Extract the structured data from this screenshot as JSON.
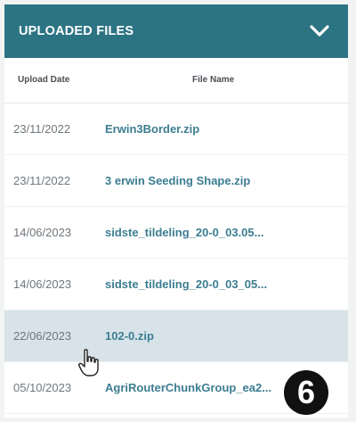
{
  "header": {
    "title": "UPLOADED FILES",
    "toggle_icon": "chevron-down-icon",
    "bg_color": "#2c7483"
  },
  "columns": {
    "upload_date": "Upload Date",
    "file_name": "File Name"
  },
  "rows": [
    {
      "date": "23/11/2022",
      "name": "Erwin3Border.zip"
    },
    {
      "date": "23/11/2022",
      "name": "3 erwin Seeding Shape.zip"
    },
    {
      "date": "14/06/2023",
      "name": "sidste_tildeling_20-0_03.05..."
    },
    {
      "date": "14/06/2023",
      "name": "sidste_tildeling_20-0_03_05..."
    },
    {
      "date": "22/06/2023",
      "name": "102-0.zip"
    },
    {
      "date": "05/10/2023",
      "name": "AgriRouterChunkGroup_ea2..."
    }
  ],
  "overlay": {
    "step_badge": "6",
    "cursor_icon": "hand-pointer-icon"
  },
  "colors": {
    "link": "#3c7d91",
    "selected_row": "#d7e3e8"
  }
}
